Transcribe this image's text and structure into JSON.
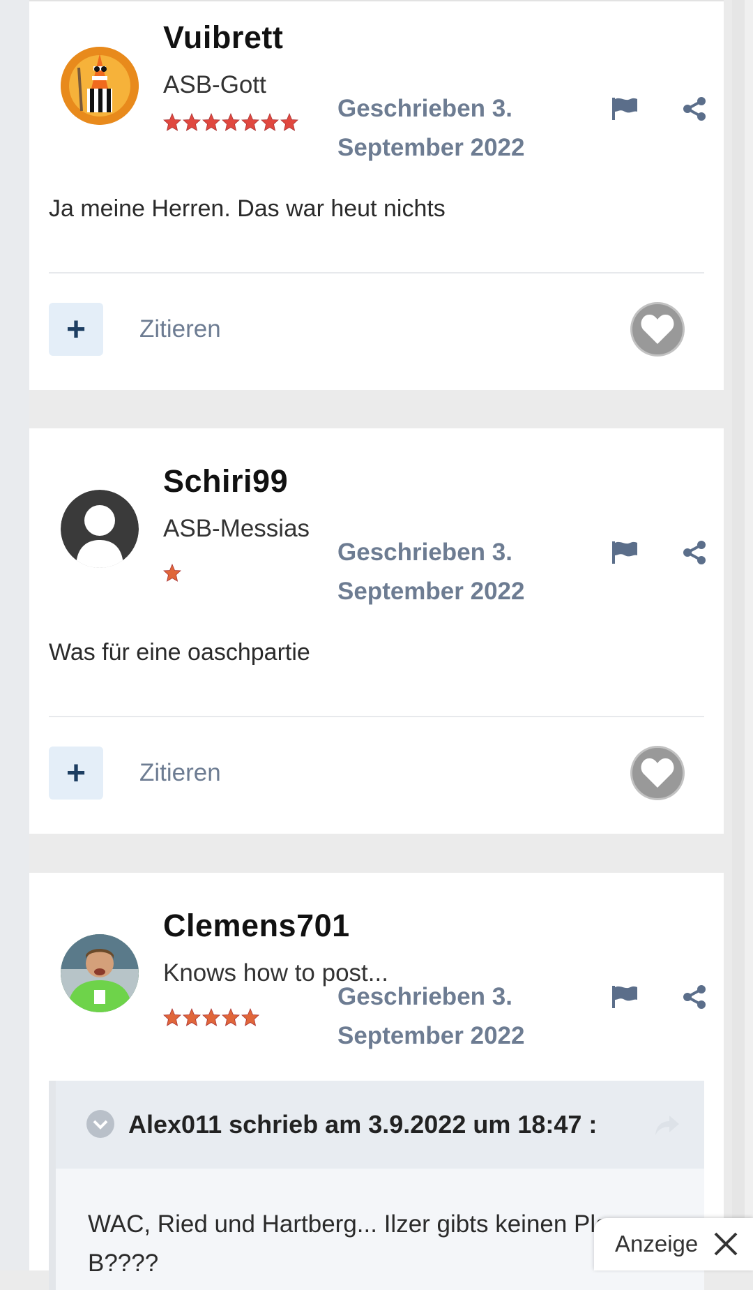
{
  "posts": [
    {
      "username": "Vuibrett",
      "rank": "ASB-Gott",
      "star_count": 7,
      "star_color": "#e0483f",
      "date": "Geschrieben 3. September 2022",
      "text": "Ja meine Herren. Das war heut nichts",
      "quote_label": "Zitieren"
    },
    {
      "username": "Schiri99",
      "rank": "ASB-Messias",
      "star_count": 1,
      "star_color": "#e0663a",
      "date": "Geschrieben 3. September 2022",
      "text": "Was für eine oaschpartie",
      "quote_label": "Zitieren"
    },
    {
      "username": "Clemens701",
      "rank": "Knows how to post...",
      "star_count": 5,
      "star_color": "#e0663a",
      "date": "Geschrieben 3. September 2022",
      "quote": {
        "author": "Alex011 schrieb am 3.9.2022 um 18:47 :",
        "text": "WAC, Ried und Hartberg... Ilzer gibts keinen Plan B????"
      }
    }
  ],
  "ad": {
    "label": "Anzeige"
  },
  "colors": {
    "accent": "#6d7c92",
    "plus_button_bg": "#e4eef8",
    "plus_color": "#1d3e62"
  }
}
